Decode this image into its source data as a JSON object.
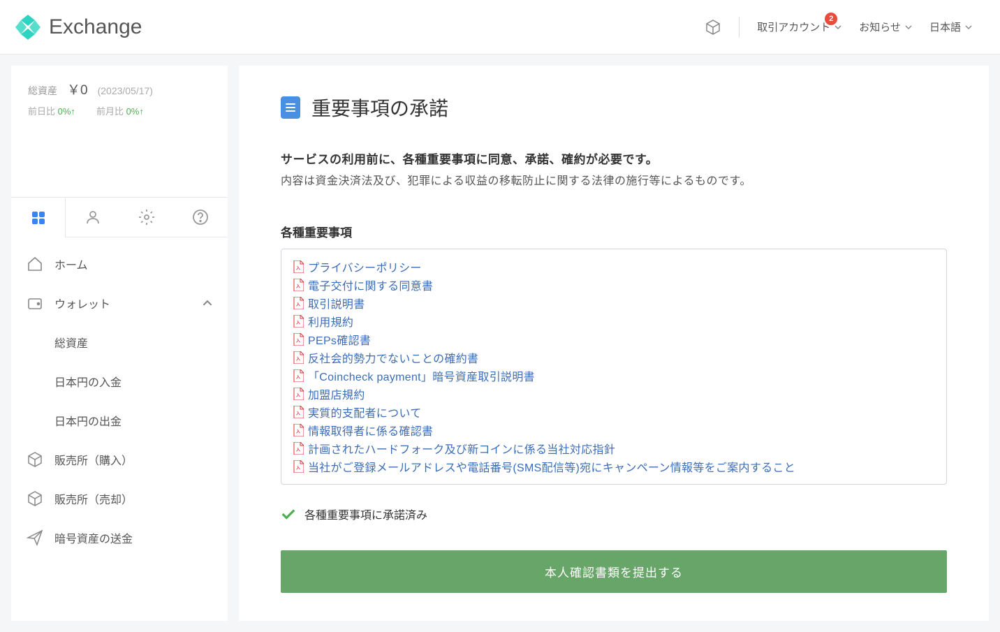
{
  "header": {
    "brand": "Exchange",
    "account_label": "取引アカウント",
    "badge_count": "2",
    "notifications_label": "お知らせ",
    "language_label": "日本語"
  },
  "sidebar": {
    "asset_label": "総資産",
    "asset_value": "￥0",
    "asset_date": "(2023/05/17)",
    "prev_day_label": "前日比",
    "prev_day_value": "0%↑",
    "prev_month_label": "前月比",
    "prev_month_value": "0%↑",
    "nav": {
      "home": "ホーム",
      "wallet": "ウォレット",
      "wallet_sub": {
        "total_assets": "総資産",
        "deposit_jpy": "日本円の入金",
        "withdraw_jpy": "日本円の出金"
      },
      "buy": "販売所（購入）",
      "sell": "販売所（売却）",
      "send_crypto": "暗号資産の送金"
    }
  },
  "main": {
    "title": "重要事項の承諾",
    "intro_bold": "サービスの利用前に、各種重要事項に同意、承諾、確約が必要です。",
    "intro_text": "内容は資金決済法及び、犯罪による収益の移転防止に関する法律の施行等によるものです。",
    "section_title": "各種重要事項",
    "documents": [
      "プライバシーポリシー",
      "電子交付に関する同意書",
      "取引説明書",
      "利用規約",
      "PEPs確認書",
      "反社会的勢力でないことの確約書",
      "「Coincheck payment」暗号資産取引説明書",
      "加盟店規約",
      "実質的支配者について",
      "情報取得者に係る確認書",
      "計画されたハードフォーク及び新コインに係る当社対応指針",
      "当社がご登録メールアドレスや電話番号(SMS配信等)宛にキャンペーン情報等をご案内すること"
    ],
    "consent_text": "各種重要事項に承諾済み",
    "submit_label": "本人確認書類を提出する"
  }
}
